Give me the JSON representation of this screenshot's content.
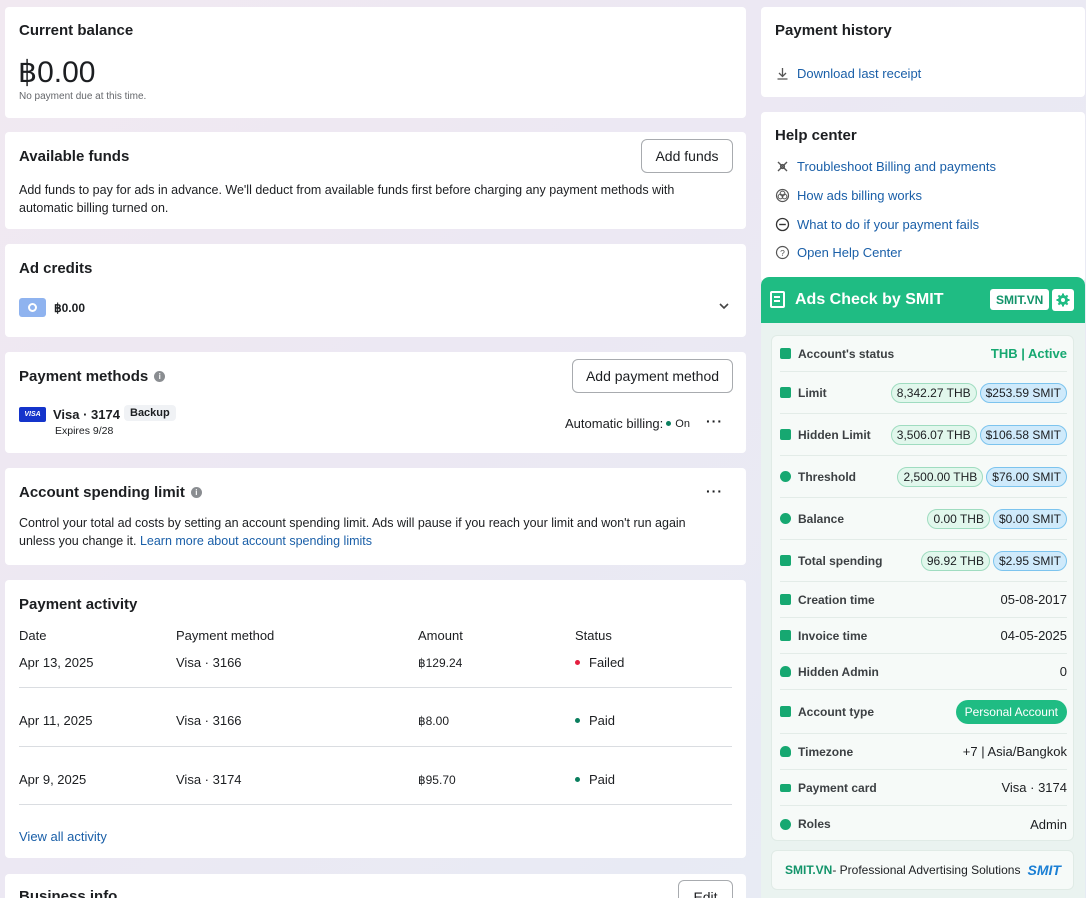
{
  "current_balance": {
    "title": "Current balance",
    "amount": "฿0.00",
    "note": "No payment due at this time."
  },
  "available_funds": {
    "title": "Available funds",
    "button": "Add funds",
    "description": "Add funds to pay for ads in advance. We'll deduct from available funds first before charging any payment methods with automatic billing turned on."
  },
  "ad_credits": {
    "title": "Ad credits",
    "amount": "฿0.00"
  },
  "payment_methods": {
    "title": "Payment methods",
    "button": "Add payment method",
    "card_brand": "VISA",
    "card_name": "Visa · 3174",
    "badge": "Backup",
    "expires": "Expires 9/28",
    "auto_billing_label": "Automatic billing:",
    "auto_billing_state": "On",
    "more": "···"
  },
  "spending_limit": {
    "title": "Account spending limit",
    "more": "···",
    "description": "Control your total ad costs by setting an account spending limit. Ads will pause if you reach your limit and won't run again unless you change it.",
    "link": "Learn more about account spending limits"
  },
  "payment_activity": {
    "title": "Payment activity",
    "headers": [
      "Date",
      "Payment method",
      "Amount",
      "Status"
    ],
    "rows": [
      {
        "date": "Apr 13, 2025",
        "method": "Visa · 3166",
        "amount": "฿129.24",
        "status": "Failed",
        "status_color": "#e41e3f"
      },
      {
        "date": "Apr 11, 2025",
        "method": "Visa · 3166",
        "amount": "฿8.00",
        "status": "Paid",
        "status_color": "#0a7e5e"
      },
      {
        "date": "Apr 9, 2025",
        "method": "Visa · 3174",
        "amount": "฿95.70",
        "status": "Paid",
        "status_color": "#0a7e5e"
      }
    ],
    "view_all": "View all activity"
  },
  "business_info": {
    "title": "Business info",
    "button": "Edit"
  },
  "payment_history": {
    "title": "Payment history",
    "download": "Download last receipt"
  },
  "help_center": {
    "title": "Help center",
    "items": [
      {
        "label": "Troubleshoot Billing and payments",
        "icon": "wrench-icon"
      },
      {
        "label": "How ads billing works",
        "icon": "globe-icon"
      },
      {
        "label": "What to do if your payment fails",
        "icon": "minus-circle-icon"
      },
      {
        "label": "Open Help Center",
        "icon": "question-circle-icon"
      }
    ]
  },
  "smit": {
    "title": "Ads Check by SMIT",
    "brand_badge": "SMIT.VN",
    "status_label": "Account's status",
    "status_value": "THB | Active",
    "limit_label": "Limit",
    "limit_thb": "8,342.27 THB",
    "limit_smit": "$253.59 SMIT",
    "hidden_limit_label": "Hidden Limit",
    "hidden_limit_thb": "3,506.07 THB",
    "hidden_limit_smit": "$106.58 SMIT",
    "threshold_label": "Threshold",
    "threshold_thb": "2,500.00 THB",
    "threshold_smit": "$76.00 SMIT",
    "balance_label": "Balance",
    "balance_thb": "0.00 THB",
    "balance_smit": "$0.00 SMIT",
    "total_spending_label": "Total spending",
    "total_spending_thb": "96.92 THB",
    "total_spending_smit": "$2.95 SMIT",
    "creation_label": "Creation time",
    "creation_value": "05-08-2017",
    "invoice_label": "Invoice time",
    "invoice_value": "04-05-2025",
    "hidden_admin_label": "Hidden Admin",
    "hidden_admin_value": "0",
    "account_type_label": "Account type",
    "account_type_value": "Personal Account",
    "timezone_label": "Timezone",
    "timezone_value": "+7 | Asia/Bangkok",
    "payment_card_label": "Payment card",
    "payment_card_value": "Visa · 3174",
    "roles_label": "Roles",
    "roles_value": "Admin",
    "footer_brand": "SMIT.VN",
    "footer_text": " - Professional Advertising Solutions",
    "footer_logo": "SMIT",
    "accent_color": "#1fbc83"
  }
}
